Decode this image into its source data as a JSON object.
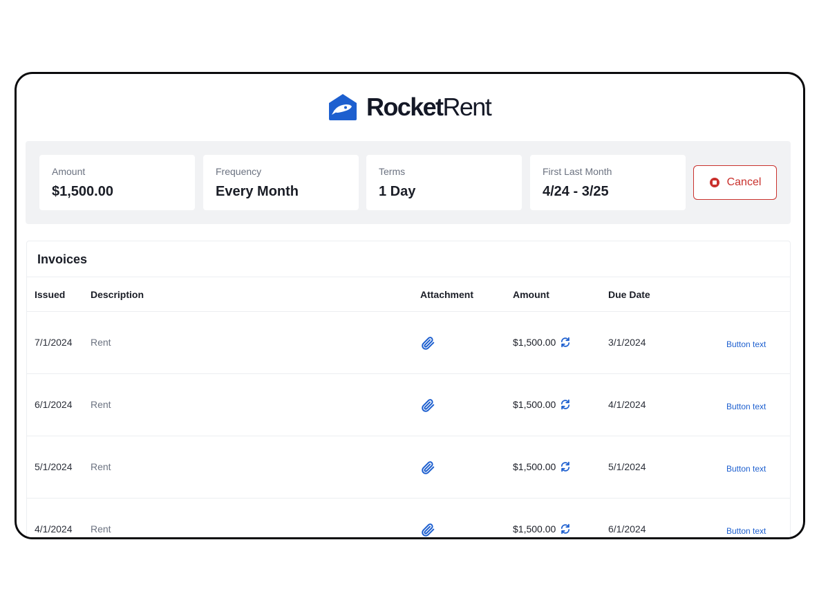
{
  "brand": {
    "name_bold": "Rocket",
    "name_regular": "Rent",
    "icon": "rocket-house-logo-icon",
    "color": "#1d5fcf"
  },
  "summary": {
    "amount": {
      "label": "Amount",
      "value": "$1,500.00"
    },
    "frequency": {
      "label": "Frequency",
      "value": "Every Month"
    },
    "terms": {
      "label": "Terms",
      "value": "1 Day"
    },
    "first_last": {
      "label": "First Last Month",
      "value": "4/24 - 3/25"
    },
    "cancel": {
      "label": "Cancel",
      "icon": "stop-circle-icon",
      "color": "#c9302c"
    }
  },
  "invoices": {
    "title": "Invoices",
    "columns": {
      "issued": "Issued",
      "description": "Description",
      "attachment": "Attachment",
      "amount": "Amount",
      "due_date": "Due Date"
    },
    "rows": [
      {
        "issued": "7/1/2024",
        "description": "Rent",
        "attachment_icon": "paperclip-icon",
        "amount": "$1,500.00",
        "amount_icon": "refresh-icon",
        "due": "3/1/2024",
        "action": "Button text"
      },
      {
        "issued": "6/1/2024",
        "description": "Rent",
        "attachment_icon": "paperclip-icon",
        "amount": "$1,500.00",
        "amount_icon": "refresh-icon",
        "due": "4/1/2024",
        "action": "Button text"
      },
      {
        "issued": "5/1/2024",
        "description": "Rent",
        "attachment_icon": "paperclip-icon",
        "amount": "$1,500.00",
        "amount_icon": "refresh-icon",
        "due": "5/1/2024",
        "action": "Button text"
      },
      {
        "issued": "4/1/2024",
        "description": "Rent",
        "attachment_icon": "paperclip-icon",
        "amount": "$1,500.00",
        "amount_icon": "refresh-icon",
        "due": "6/1/2024",
        "action": "Button text"
      }
    ]
  }
}
